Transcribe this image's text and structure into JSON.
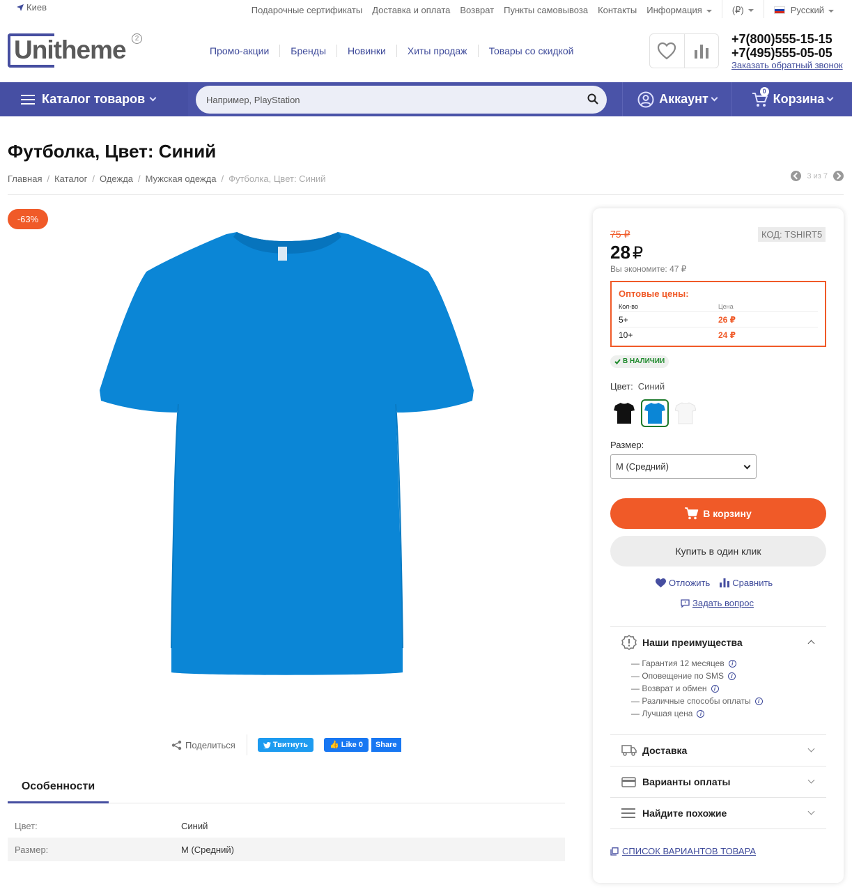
{
  "topbar": {
    "city": "Киев",
    "links": [
      "Подарочные сертификаты",
      "Доставка и оплата",
      "Возврат",
      "Пункты самовывоза",
      "Контакты"
    ],
    "info": "Информация",
    "currency": "(₽)",
    "language": "Русский"
  },
  "header": {
    "logo_text": "Unitheme",
    "logo_badge": "2",
    "nav": [
      "Промо-акции",
      "Бренды",
      "Новинки",
      "Хиты продаж",
      "Товары со скидкой"
    ],
    "phone1": "+7(800)555-15-15",
    "phone2": "+7(495)555-05-05",
    "callback": "Заказать обратный звонок"
  },
  "navbar": {
    "catalog": "Каталог товаров",
    "search_placeholder": "Например, PlayStation",
    "account": "Аккаунт",
    "cart": "Корзина",
    "cart_count": "0"
  },
  "page": {
    "title": "Футболка, Цвет: Синий",
    "breadcrumbs": [
      "Главная",
      "Каталог",
      "Одежда",
      "Мужская одежда"
    ],
    "breadcrumb_current": "Футболка, Цвет: Синий",
    "pager": "3 из 7"
  },
  "gallery": {
    "discount": "-63%",
    "share_label": "Поделиться",
    "tweet": "Твитнуть",
    "fb_like": "Like 0",
    "fb_share": "Share"
  },
  "features": {
    "tab": "Особенности",
    "rows": [
      {
        "key": "Цвет:",
        "value": "Синий"
      },
      {
        "key": "Размер:",
        "value": "M (Средний)"
      }
    ]
  },
  "product": {
    "old_price": "75 ₽",
    "code": "КОД: TSHIRT5",
    "price": "28",
    "currency": "₽",
    "savings": "Вы экономите: 47 ₽",
    "wholesale_title": "Оптовые цены:",
    "wholesale_head": {
      "qty": "Кол-во",
      "price": "Цена"
    },
    "wholesale": [
      {
        "qty": "5+",
        "price": "26 ₽"
      },
      {
        "qty": "10+",
        "price": "24 ₽"
      }
    ],
    "stock": "В НАЛИЧИИ",
    "color_label": "Цвет:",
    "color_value": "Синий",
    "swatches": [
      "black",
      "blue",
      "white"
    ],
    "size_label": "Размер:",
    "size_value": "M (Средний)",
    "add_to_cart": "В корзину",
    "one_click": "Купить в один клик",
    "wishlist": "Отложить",
    "compare": "Сравнить",
    "ask": "Задать вопрос",
    "advantages_title": "Наши преимущества",
    "advantages": [
      "— Гарантия 12 месяцев",
      "— Оповещение по SMS",
      "— Возврат и обмен",
      "— Различные способы оплаты",
      "— Лучшая цена"
    ],
    "delivery": "Доставка",
    "payment": "Варианты оплаты",
    "similar": "Найдите похожие",
    "variants_link": "СПИСОК ВАРИАНТОВ ТОВАРА"
  },
  "colors": {
    "brand": "#4a53a8",
    "accent": "#f05a28",
    "shirt": "#0b86d6"
  }
}
